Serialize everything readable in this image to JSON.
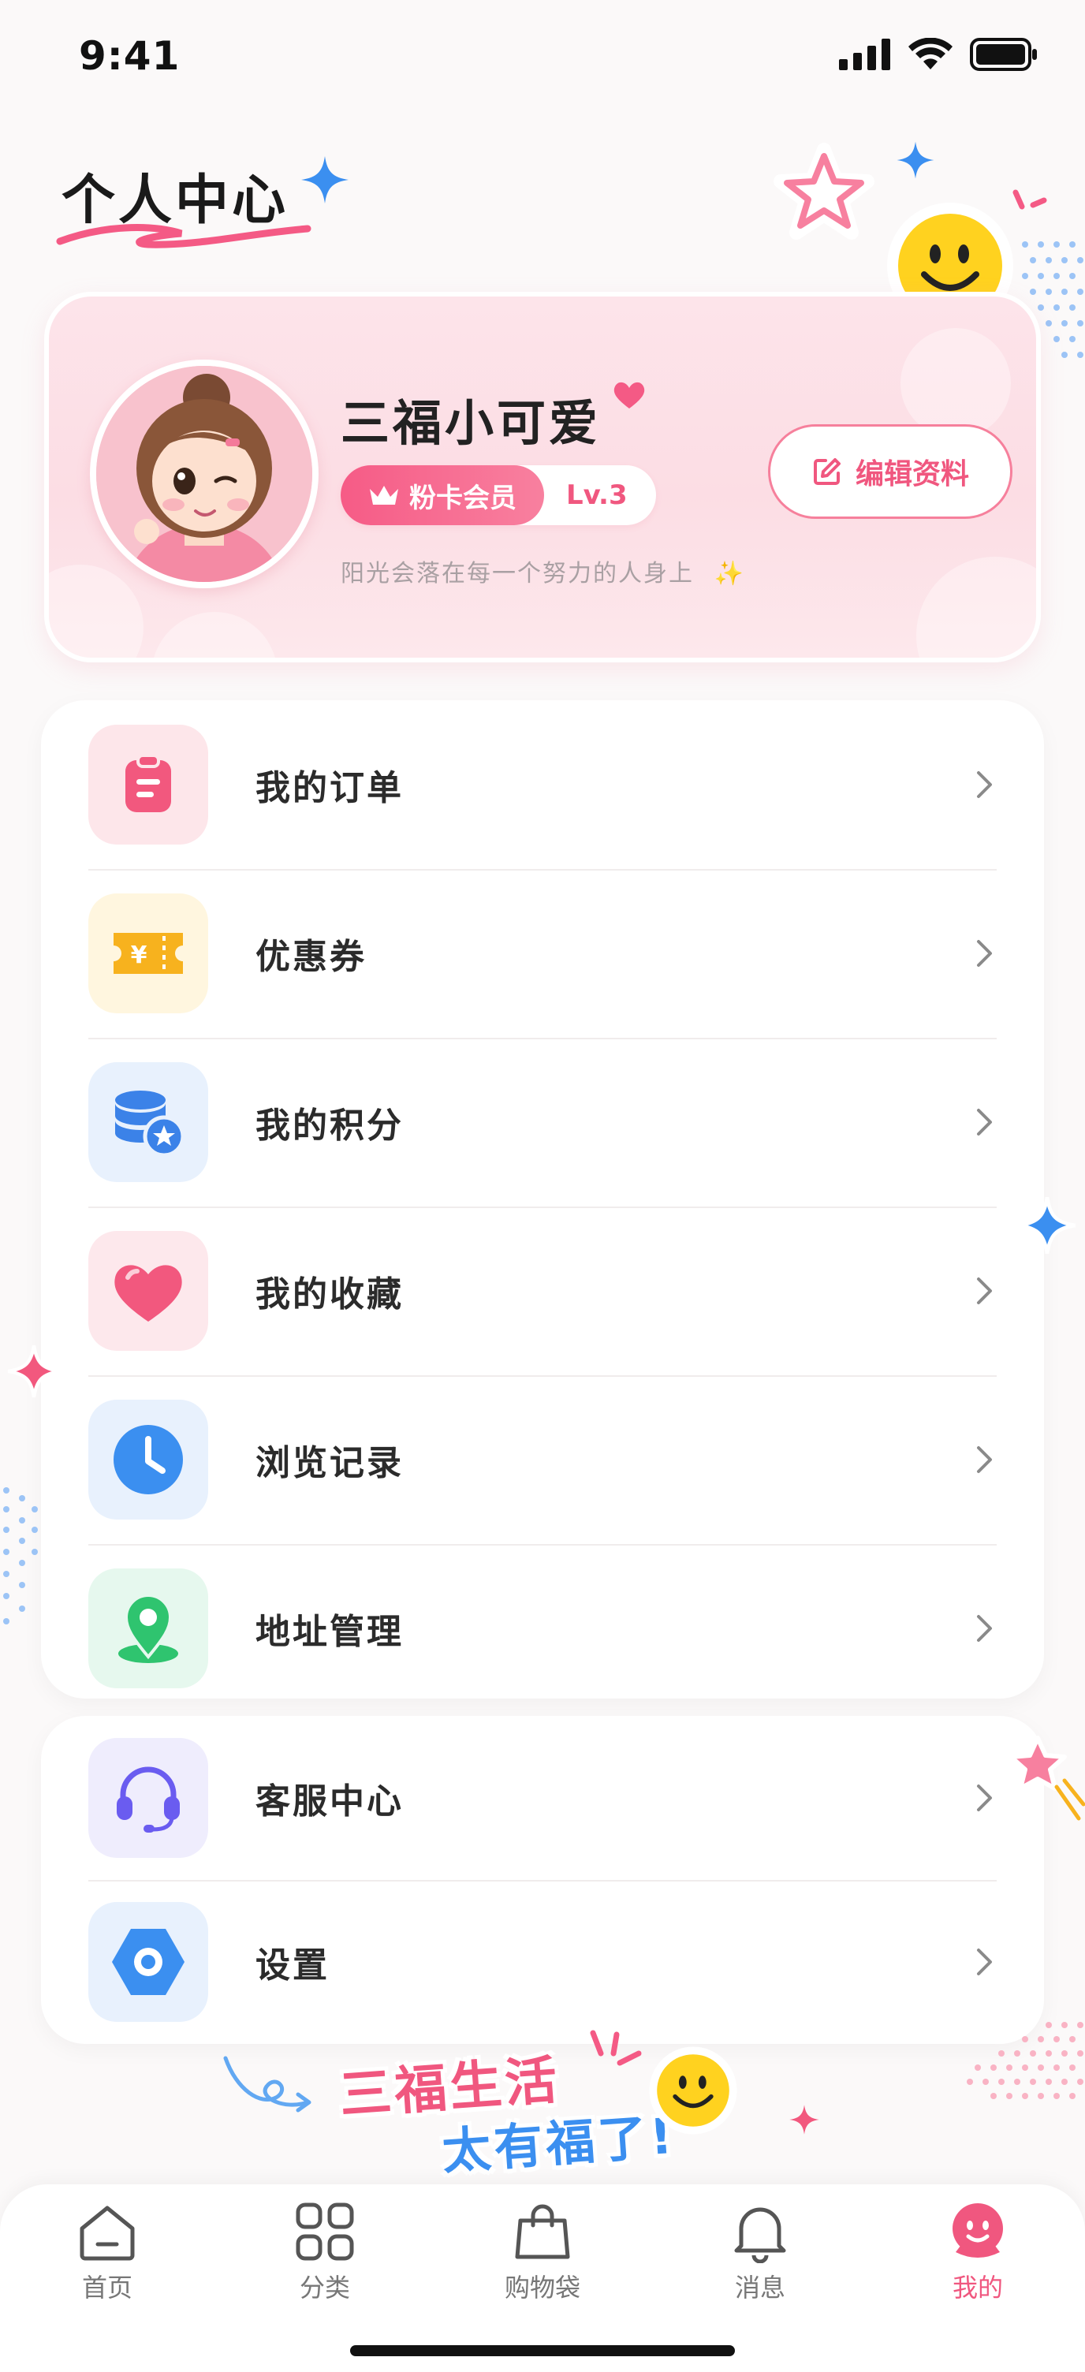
{
  "status_bar": {
    "time": "9:41"
  },
  "page": {
    "title": "个人中心"
  },
  "profile": {
    "name": "三福小可爱",
    "member_badge": "粉卡会员",
    "level": "Lv.3",
    "motto": "阳光会落在每一个努力的人身上",
    "edit_label": "编辑资料"
  },
  "menu_primary": [
    {
      "label": "我的订单",
      "icon": "clipboard-icon",
      "tile_color": "#fde6ea",
      "icon_color": "#f2587e"
    },
    {
      "label": "优惠券",
      "icon": "coupon-icon",
      "tile_color": "#fff6df",
      "icon_color": "#f7b21e"
    },
    {
      "label": "我的积分",
      "icon": "coins-star-icon",
      "tile_color": "#e8f1fd",
      "icon_color": "#3b82e8"
    },
    {
      "label": "我的收藏",
      "icon": "heart-icon",
      "tile_color": "#fde8ec",
      "icon_color": "#f2587e"
    },
    {
      "label": "浏览记录",
      "icon": "clock-icon",
      "tile_color": "#e8f1fd",
      "icon_color": "#3b8ff0"
    },
    {
      "label": "地址管理",
      "icon": "location-pin-icon",
      "tile_color": "#e6f8ee",
      "icon_color": "#2fc46f"
    }
  ],
  "menu_secondary": [
    {
      "label": "客服中心",
      "icon": "headset-icon",
      "tile_color": "#efedfd",
      "icon_color": "#6a5cf0"
    },
    {
      "label": "设置",
      "icon": "settings-icon",
      "tile_color": "#e8f1fd",
      "icon_color": "#3b8ff0"
    }
  ],
  "slogan": {
    "line1": "三福生活",
    "line2": "太有福了!"
  },
  "tabbar": [
    {
      "label": "首页",
      "icon": "home-icon",
      "active": false
    },
    {
      "label": "分类",
      "icon": "grid-icon",
      "active": false
    },
    {
      "label": "购物袋",
      "icon": "shopping-bag-icon",
      "active": false
    },
    {
      "label": "消息",
      "icon": "bell-icon",
      "active": false
    },
    {
      "label": "我的",
      "icon": "profile-face-icon",
      "active": true
    }
  ],
  "colors": {
    "accent": "#f0577f",
    "accent_light": "#fde4ea",
    "background": "#fbf9f9"
  }
}
